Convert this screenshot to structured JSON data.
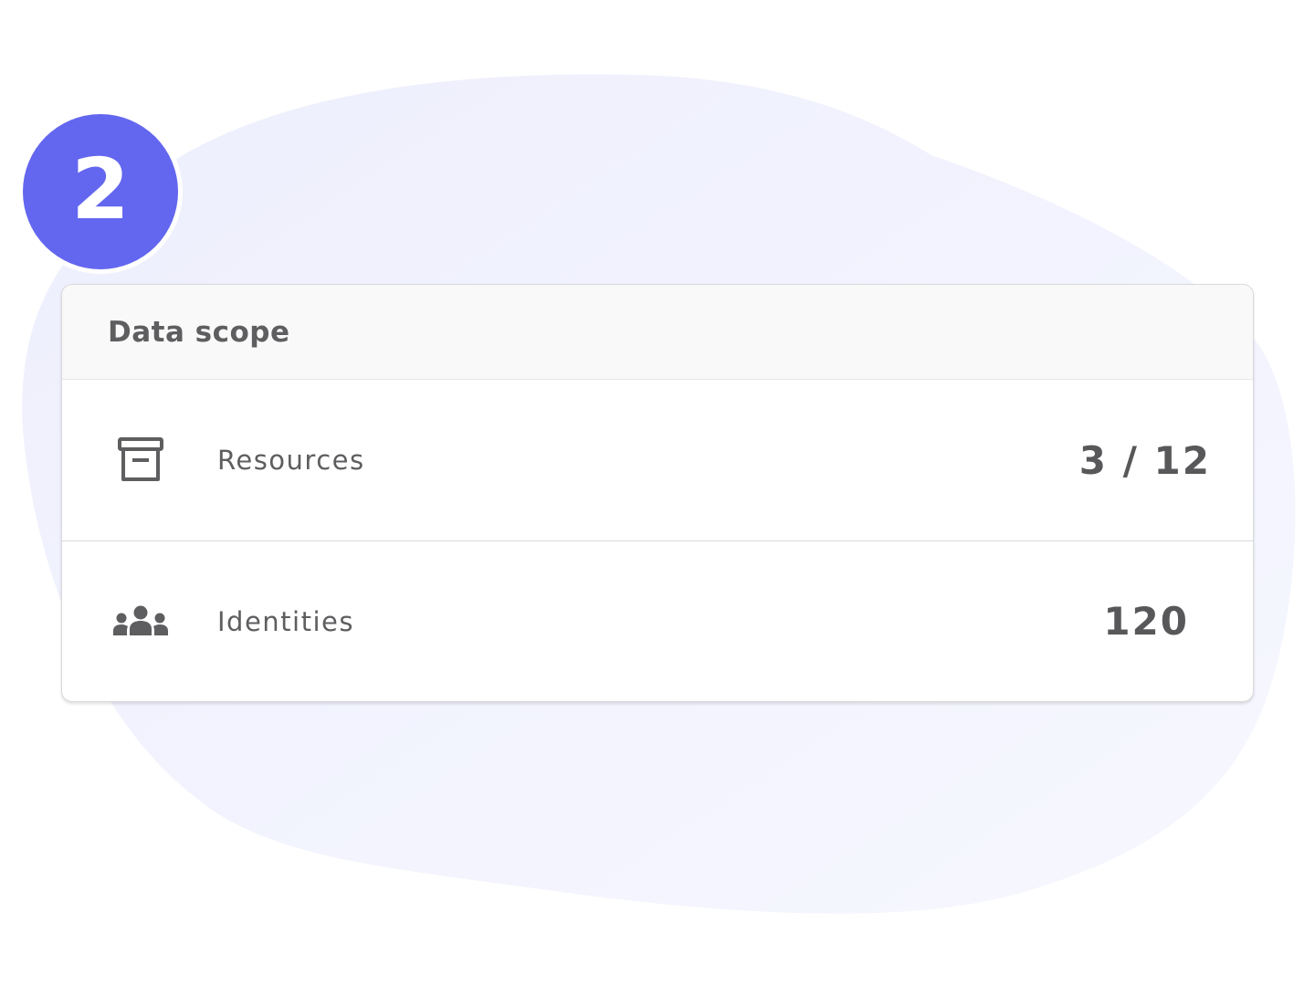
{
  "step": {
    "number": "2"
  },
  "card": {
    "title": "Data scope",
    "rows": [
      {
        "icon": "archive-box-icon",
        "label": "Resources",
        "value": "3 / 12"
      },
      {
        "icon": "people-group-icon",
        "label": "Identities",
        "value": "120"
      }
    ]
  },
  "colors": {
    "accent": "#6366ee",
    "blob": "#eef0fc",
    "text": "#5e5e60",
    "header_bg": "#f9f9f9"
  }
}
